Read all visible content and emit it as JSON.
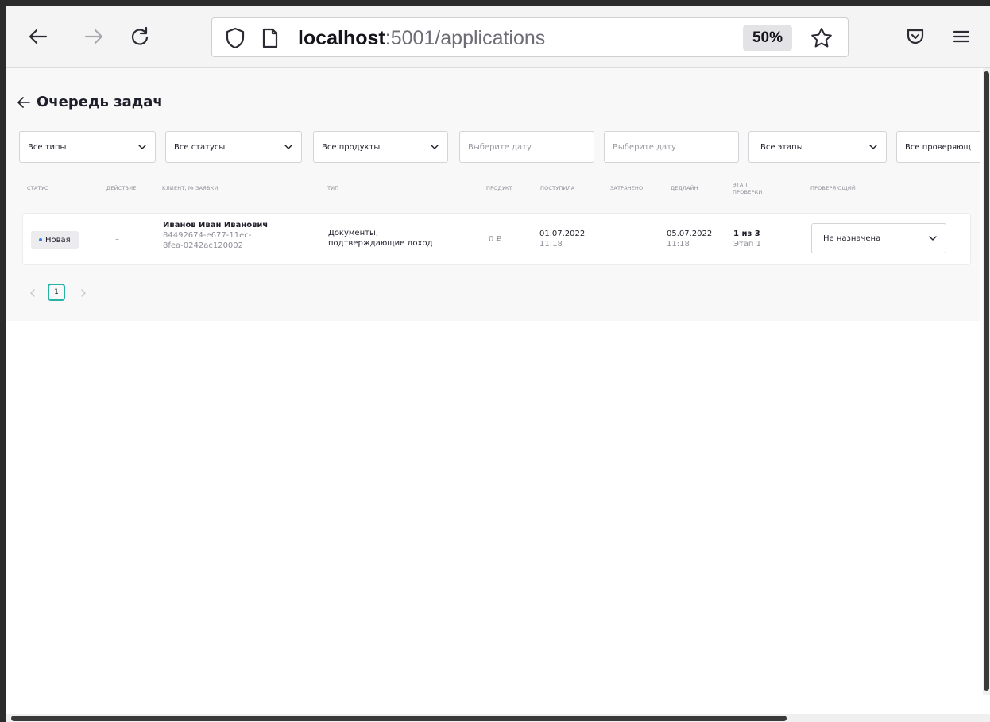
{
  "browser": {
    "url_host": "localhost",
    "url_rest": ":5001/applications",
    "zoom": "50%"
  },
  "page": {
    "title": "Очередь задач"
  },
  "filters": {
    "types": "Все типы",
    "statuses": "Все статусы",
    "products": "Все продукты",
    "date_from_placeholder": "Выберите дату",
    "date_to_placeholder": "Выберите дату",
    "stages": "Все этапы",
    "reviewers": "Все проверяющ"
  },
  "table": {
    "headers": {
      "status": "Статус",
      "action": "Действие",
      "client": "Клиент, № заявки",
      "type": "Тип",
      "product": "Продукт",
      "received": "Поступила",
      "spent": "Затрачено",
      "deadline": "Дедлайн",
      "stage_line1": "Этап",
      "stage_line2": "проверки",
      "reviewer": "Проверяющий"
    },
    "rows": [
      {
        "status": "Новая",
        "action": "–",
        "client_name": "Иванов Иван Иванович",
        "app_id_line1": "84492674-e677-11ec-",
        "app_id_line2": "8fea-0242ac120002",
        "type_line1": "Документы,",
        "type_line2": "подтверждающие доход",
        "product": "0 ₽",
        "received_date": "01.07.2022",
        "received_time": "11:18",
        "deadline_date": "05.07.2022",
        "deadline_time": "11:18",
        "stage_progress": "1 из 3",
        "stage_name": "Этап 1",
        "reviewer": "Не назначена"
      }
    ]
  },
  "pagination": {
    "current": "1"
  }
}
